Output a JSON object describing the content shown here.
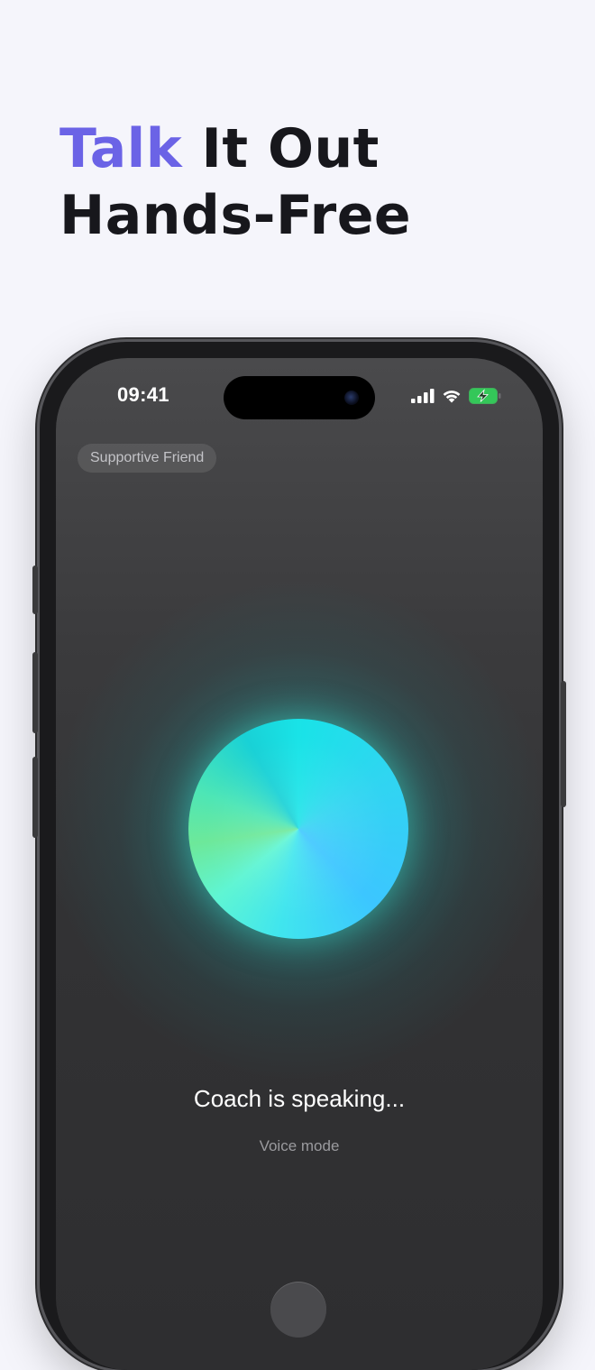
{
  "headline": {
    "accent": "Talk",
    "rest": " It Out",
    "line2": "Hands-Free"
  },
  "status_bar": {
    "time": "09:41",
    "icons": [
      "cellular-signal-icon",
      "wifi-icon",
      "battery-charging-icon"
    ]
  },
  "persona_label": "Supportive Friend",
  "voice": {
    "status": "Coach is speaking...",
    "mode": "Voice mode"
  },
  "colors": {
    "accent": "#6b63e6",
    "headline_text": "#17171c",
    "background": "#f5f5fb",
    "battery": "#34c759",
    "orb_cyan": "#19e3e7",
    "orb_blue": "#3cc6ff",
    "orb_green": "#6de89a"
  }
}
